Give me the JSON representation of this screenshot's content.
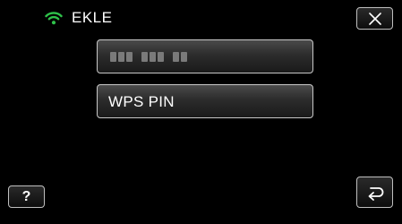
{
  "header": {
    "title": "EKLE",
    "status_icon": "wifi-icon",
    "status_color": "#2fc24a"
  },
  "main": {
    "pin_field": {
      "value": "■■■ ■■■ ■■",
      "digit_groups": [
        3,
        3,
        2
      ]
    },
    "wps_pin_label": "WPS PIN"
  },
  "controls": {
    "close_icon": "close-icon",
    "help_label": "?",
    "back_icon": "back-arrow-icon"
  },
  "colors": {
    "background": "#000000",
    "button_border": "#c8c8c8",
    "text": "#ffffff"
  }
}
